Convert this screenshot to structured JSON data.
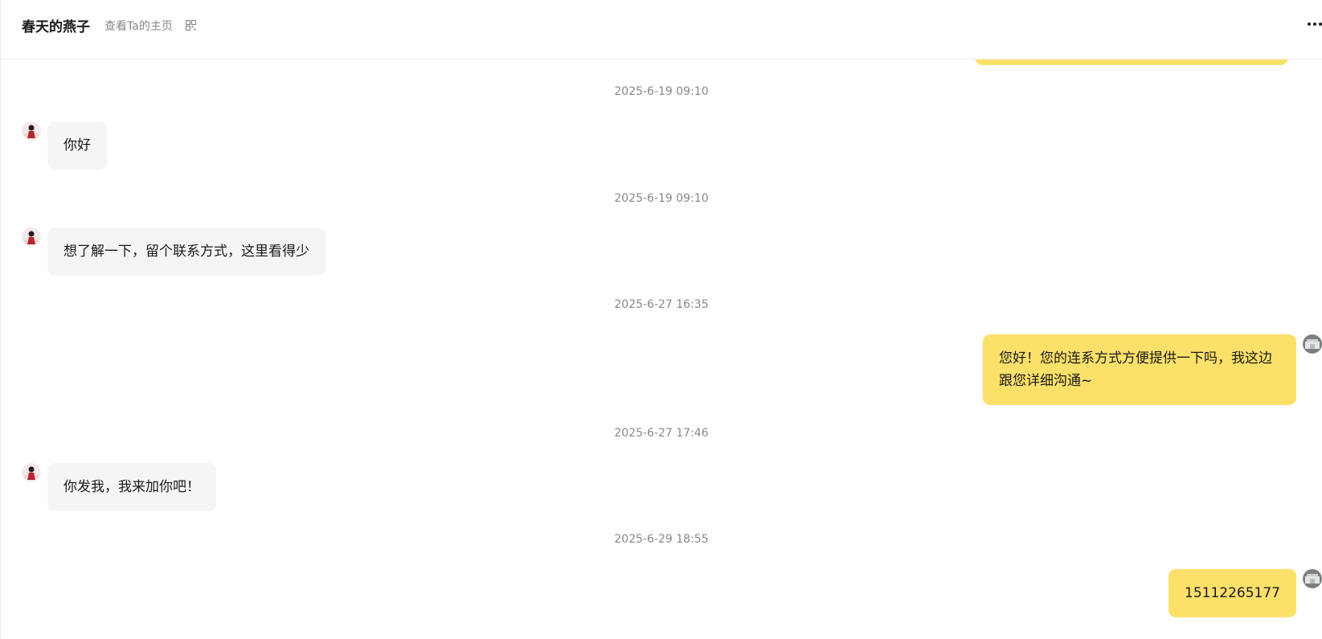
{
  "header": {
    "contact_name": "春天的燕子",
    "profile_link": "查看Ta的主页"
  },
  "messages": [
    {
      "time": "2025-6-19 09:10",
      "side": "left",
      "text": "你好"
    },
    {
      "time": "2025-6-19 09:10",
      "side": "left",
      "text": "想了解一下，留个联系方式，这里看得少"
    },
    {
      "time": "2025-6-27 16:35",
      "side": "right",
      "text": "您好！您的连系方式方便提供一下吗，我这边跟您详细沟通~"
    },
    {
      "time": "2025-6-27 17:46",
      "side": "left",
      "text": "你发我，我来加你吧！"
    },
    {
      "time": "2025-6-29 18:55",
      "side": "right",
      "text": "15112265177"
    }
  ],
  "colors": {
    "own_bubble": "#fbe06a",
    "other_bubble": "#f5f5f5",
    "timestamp": "#888888"
  },
  "icons": {
    "qr": "qr-code-icon",
    "more": "more-dots-icon"
  }
}
